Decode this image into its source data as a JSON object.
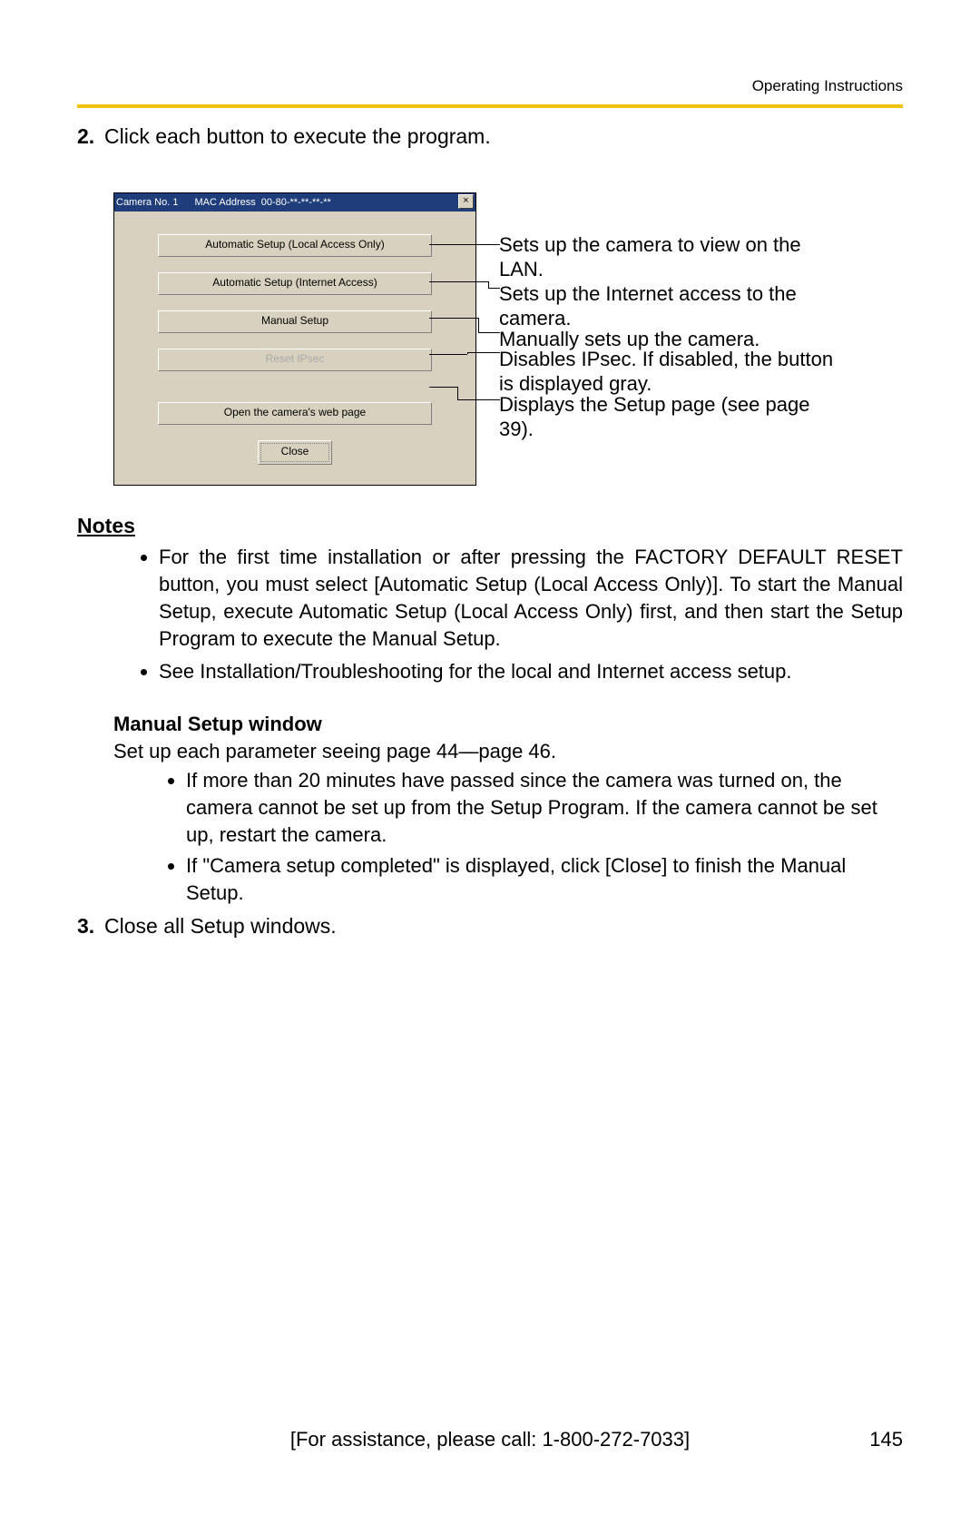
{
  "header": {
    "section": "Operating Instructions"
  },
  "steps": {
    "s2_num": "2.",
    "s2_text": "Click each button to execute the program.",
    "s3_num": "3.",
    "s3_text": "Close all Setup windows."
  },
  "dialog": {
    "title_left": "Camera No. 1",
    "title_mac_label": "MAC Address",
    "title_mac_value": "00-80-**-**-**-**",
    "close_x": "×",
    "btn_auto_local": "Automatic Setup (Local Access Only)",
    "btn_auto_inet": "Automatic Setup (Internet Access)",
    "btn_manual": "Manual Setup",
    "btn_reset": "Reset IPsec",
    "btn_open": "Open the camera's web page",
    "btn_close": "Close"
  },
  "callouts": {
    "c1": "Sets up the camera to view on the LAN.",
    "c2": "Sets up the Internet access to the camera.",
    "c3": "Manually sets up the camera.",
    "c4": "Disables IPsec. If disabled, the button is displayed gray.",
    "c5": "Displays the Setup page (see page 39)."
  },
  "notes": {
    "heading": "Notes",
    "n1": "For the first time installation or after pressing the FACTORY DEFAULT RESET button, you must select [Automatic Setup (Local Access Only)]. To start the Manual Setup, execute Automatic Setup (Local Access Only) first, and then start the Setup Program to execute the Manual Setup.",
    "n2": "See Installation/Troubleshooting for the local and Internet access setup."
  },
  "manual": {
    "heading": "Manual Setup window",
    "line": "Set up each parameter seeing page 44—page 46.",
    "b1": "If more than 20 minutes have passed since the camera was turned on, the camera cannot be set up from the Setup Program. If the camera cannot be set up, restart the camera.",
    "b2": "If \"Camera setup completed\" is displayed, click [Close] to finish the Manual Setup."
  },
  "footer": {
    "assist": "[For assistance, please call: 1-800-272-7033]",
    "page_num": "145"
  }
}
